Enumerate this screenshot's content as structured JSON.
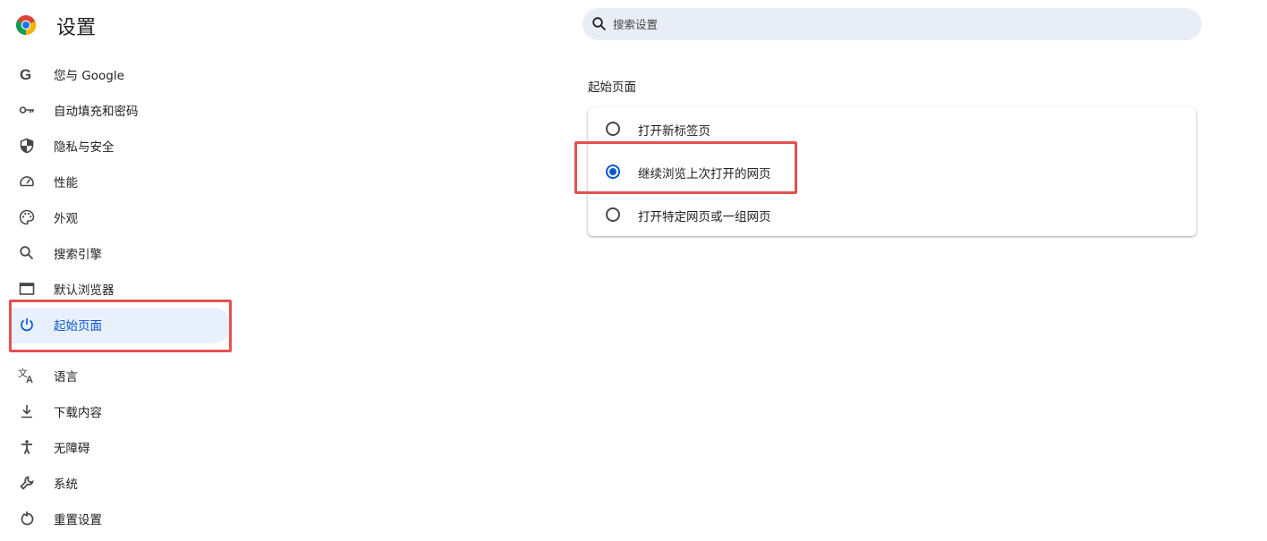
{
  "app": {
    "title": "设置"
  },
  "search": {
    "placeholder": "搜索设置",
    "value": ""
  },
  "sidebar": {
    "items": [
      {
        "label": "您与 Google",
        "icon": "google-icon"
      },
      {
        "label": "自动填充和密码",
        "icon": "key-icon"
      },
      {
        "label": "隐私与安全",
        "icon": "shield-icon"
      },
      {
        "label": "性能",
        "icon": "speedometer-icon"
      },
      {
        "label": "外观",
        "icon": "palette-icon"
      },
      {
        "label": "搜索引擎",
        "icon": "search-icon"
      },
      {
        "label": "默认浏览器",
        "icon": "browser-window-icon"
      },
      {
        "label": "起始页面",
        "icon": "power-icon",
        "active": true
      },
      {
        "label": "语言",
        "icon": "translate-icon"
      },
      {
        "label": "下载内容",
        "icon": "download-icon"
      },
      {
        "label": "无障碍",
        "icon": "accessibility-icon"
      },
      {
        "label": "系统",
        "icon": "wrench-icon"
      },
      {
        "label": "重置设置",
        "icon": "reset-icon"
      }
    ]
  },
  "startup": {
    "title": "起始页面",
    "options": [
      {
        "label": "打开新标签页",
        "checked": false
      },
      {
        "label": "继续浏览上次打开的网页",
        "checked": true
      },
      {
        "label": "打开特定网页或一组网页",
        "checked": false
      }
    ]
  },
  "colors": {
    "accent": "#0b57d0",
    "active_bg": "#e8f0fd",
    "highlight": "#e5504f",
    "search_bg": "#e9eef6"
  }
}
